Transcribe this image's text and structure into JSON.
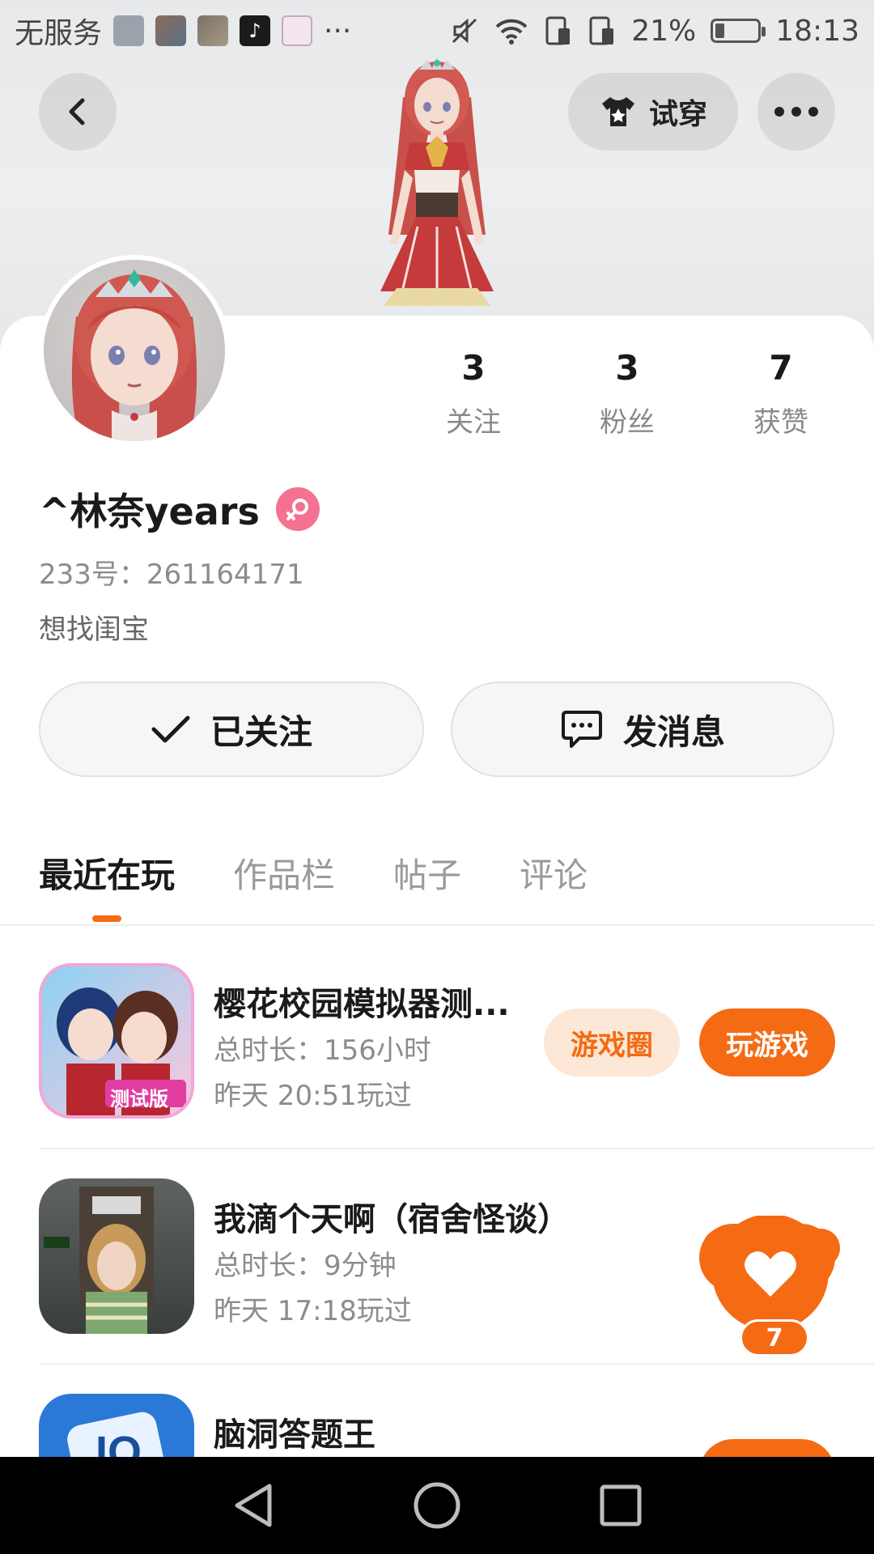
{
  "status_bar": {
    "carrier": "无服务",
    "overflow": "···",
    "battery_pct": "21%",
    "time": "18:13"
  },
  "header": {
    "tryon_label": "试穿"
  },
  "profile": {
    "username": "^林奈years",
    "uid": "233号：261164171",
    "bio": "想找闺宝",
    "stats": [
      {
        "value": "3",
        "label": "关注"
      },
      {
        "value": "3",
        "label": "粉丝"
      },
      {
        "value": "7",
        "label": "获赞"
      }
    ],
    "follow_label": "已关注",
    "message_label": "发消息"
  },
  "tabs": [
    "最近在玩",
    "作品栏",
    "帖子",
    "评论"
  ],
  "games": [
    {
      "title": "樱花校园模拟器测...",
      "duration": "总时长：156小时",
      "last_played": "昨天 20:51玩过",
      "circle_label": "游戏圈",
      "play_label": "玩游戏",
      "icon_badge": "测试版"
    },
    {
      "title": "我滴个天啊（宿舍怪谈）",
      "duration": "总时长：9分钟",
      "last_played": "昨天 17:18玩过"
    },
    {
      "title": "脑洞答题王"
    }
  ],
  "like_fab": {
    "count": "7"
  },
  "colors": {
    "accent": "#f46b14",
    "accent_light": "#fde7d7",
    "gender": "#f4728f"
  }
}
